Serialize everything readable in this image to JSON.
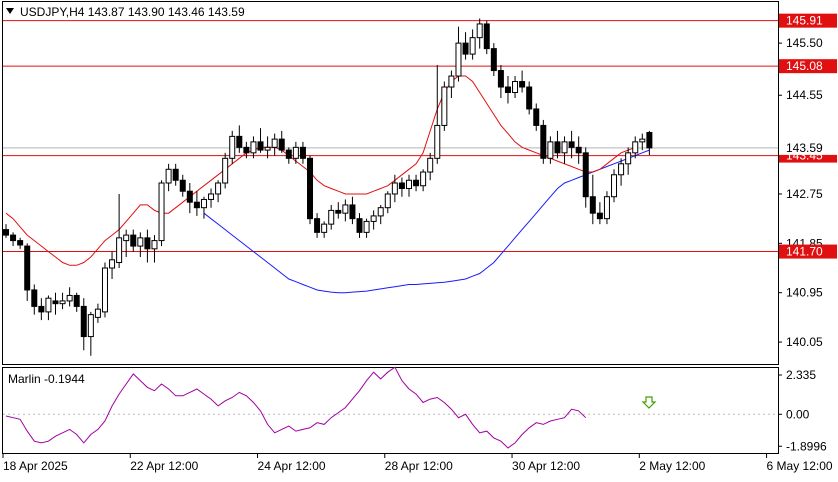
{
  "header": {
    "symbol_line": "USDJPY,H4  143.87 143.90 143.46 143.59"
  },
  "indicator": {
    "label": "Marlin -0.1944"
  },
  "colors": {
    "bull": "#ffffff",
    "bear": "#000000",
    "red_line": "#e01010",
    "blue_line": "#1a1aff",
    "marlin": "#a000a0",
    "level": "#e01010",
    "arrow": "#40a000",
    "grid": "#bbbbbb"
  },
  "chart_data": [
    {
      "type": "candlestick",
      "title": "USDJPY,H4",
      "ylim": [
        139.65,
        146.25
      ],
      "y_ticks": [
        "145.50",
        "144.55",
        "143.50",
        "142.75",
        "141.85",
        "140.95",
        "140.05"
      ],
      "y_tick_values": [
        145.5,
        144.55,
        143.5,
        142.75,
        141.85,
        140.95,
        140.05
      ],
      "x_labels": [
        "18 Apr 2025",
        "22 Apr 12:00",
        "24 Apr 12:00",
        "28 Apr 12:00",
        "30 Apr 12:00",
        "2 May 12:00",
        "6 May 12:00"
      ],
      "x_label_index": [
        0,
        18,
        36,
        54,
        72,
        90,
        108
      ],
      "current_price": "143.59",
      "levels": [
        {
          "value": 145.91,
          "label": "145.91"
        },
        {
          "value": 145.08,
          "label": "145.08"
        },
        {
          "value": 143.45,
          "label": "143.45"
        },
        {
          "value": 141.7,
          "label": "141.70"
        }
      ],
      "candles": [
        [
          142.1,
          142.2,
          141.95,
          142.0
        ],
        [
          142.0,
          142.05,
          141.8,
          141.9
        ],
        [
          141.9,
          141.95,
          141.75,
          141.82
        ],
        [
          141.8,
          141.85,
          140.8,
          141.0
        ],
        [
          141.0,
          141.1,
          140.55,
          140.7
        ],
        [
          140.7,
          140.85,
          140.45,
          140.6
        ],
        [
          140.6,
          140.9,
          140.45,
          140.85
        ],
        [
          140.8,
          140.95,
          140.55,
          140.75
        ],
        [
          140.75,
          140.95,
          140.65,
          140.8
        ],
        [
          140.8,
          141.05,
          140.7,
          140.9
        ],
        [
          140.9,
          140.95,
          140.6,
          140.7
        ],
        [
          140.7,
          140.85,
          139.9,
          140.15
        ],
        [
          140.15,
          140.6,
          139.8,
          140.55
        ],
        [
          140.5,
          140.75,
          140.4,
          140.65
        ],
        [
          140.6,
          141.5,
          140.5,
          141.4
        ],
        [
          141.4,
          141.7,
          141.2,
          141.55
        ],
        [
          141.5,
          142.75,
          141.4,
          141.95
        ],
        [
          141.9,
          142.1,
          141.6,
          142.0
        ],
        [
          142.0,
          142.1,
          141.7,
          141.8
        ],
        [
          141.8,
          142.05,
          141.6,
          141.95
        ],
        [
          141.95,
          142.1,
          141.5,
          141.75
        ],
        [
          141.75,
          142.0,
          141.5,
          141.9
        ],
        [
          141.9,
          143.0,
          141.8,
          142.95
        ],
        [
          142.95,
          143.3,
          142.8,
          143.2
        ],
        [
          143.2,
          143.3,
          142.9,
          143.0
        ],
        [
          143.0,
          143.1,
          142.7,
          142.8
        ],
        [
          142.8,
          142.95,
          142.4,
          142.6
        ],
        [
          142.6,
          142.8,
          142.35,
          142.5
        ],
        [
          142.5,
          142.7,
          142.3,
          142.65
        ],
        [
          142.65,
          142.85,
          142.5,
          142.75
        ],
        [
          142.75,
          143.0,
          142.6,
          142.95
        ],
        [
          142.95,
          143.5,
          142.85,
          143.4
        ],
        [
          143.4,
          143.9,
          143.3,
          143.8
        ],
        [
          143.8,
          144.0,
          143.5,
          143.6
        ],
        [
          143.6,
          143.7,
          143.4,
          143.5
        ],
        [
          143.5,
          143.8,
          143.4,
          143.7
        ],
        [
          143.7,
          143.95,
          143.5,
          143.55
        ],
        [
          143.55,
          143.8,
          143.4,
          143.6
        ],
        [
          143.6,
          143.85,
          143.45,
          143.75
        ],
        [
          143.75,
          143.9,
          143.5,
          143.55
        ],
        [
          143.55,
          143.6,
          143.3,
          143.4
        ],
        [
          143.4,
          143.7,
          143.3,
          143.6
        ],
        [
          143.6,
          143.7,
          143.3,
          143.4
        ],
        [
          143.4,
          143.45,
          142.2,
          142.3
        ],
        [
          142.3,
          142.4,
          141.95,
          142.05
        ],
        [
          142.05,
          142.25,
          141.95,
          142.2
        ],
        [
          142.2,
          142.55,
          142.1,
          142.45
        ],
        [
          142.45,
          142.6,
          142.3,
          142.4
        ],
        [
          142.4,
          142.65,
          142.25,
          142.55
        ],
        [
          142.55,
          142.7,
          142.2,
          142.3
        ],
        [
          142.3,
          142.4,
          141.95,
          142.05
        ],
        [
          142.05,
          142.3,
          141.95,
          142.25
        ],
        [
          142.25,
          142.45,
          142.1,
          142.35
        ],
        [
          142.35,
          142.55,
          142.2,
          142.5
        ],
        [
          142.5,
          142.8,
          142.4,
          142.75
        ],
        [
          142.75,
          143.1,
          142.6,
          142.95
        ],
        [
          142.95,
          143.05,
          142.7,
          142.85
        ],
        [
          142.85,
          143.1,
          142.7,
          143.0
        ],
        [
          143.0,
          143.1,
          142.8,
          142.9
        ],
        [
          142.9,
          143.2,
          142.8,
          143.15
        ],
        [
          143.15,
          143.5,
          143.0,
          143.4
        ],
        [
          143.4,
          145.1,
          143.3,
          144.0
        ],
        [
          144.0,
          144.8,
          143.9,
          144.7
        ],
        [
          144.7,
          145.0,
          144.5,
          144.9
        ],
        [
          144.9,
          145.8,
          144.8,
          145.5
        ],
        [
          145.5,
          145.7,
          145.2,
          145.3
        ],
        [
          145.3,
          145.75,
          145.2,
          145.6
        ],
        [
          145.6,
          145.95,
          145.4,
          145.85
        ],
        [
          145.85,
          145.91,
          145.3,
          145.4
        ],
        [
          145.4,
          145.5,
          144.9,
          145.0
        ],
        [
          145.0,
          145.1,
          144.5,
          144.7
        ],
        [
          144.7,
          144.9,
          144.4,
          144.6
        ],
        [
          144.6,
          144.9,
          144.5,
          144.8
        ],
        [
          144.8,
          145.0,
          144.6,
          144.7
        ],
        [
          144.7,
          144.8,
          144.2,
          144.3
        ],
        [
          144.3,
          144.4,
          143.9,
          144.0
        ],
        [
          144.0,
          144.1,
          143.3,
          143.4
        ],
        [
          143.4,
          143.8,
          143.3,
          143.7
        ],
        [
          143.7,
          143.9,
          143.4,
          143.5
        ],
        [
          143.5,
          143.8,
          143.3,
          143.7
        ],
        [
          143.7,
          143.9,
          143.4,
          143.6
        ],
        [
          143.6,
          143.8,
          143.3,
          143.5
        ],
        [
          143.5,
          143.6,
          142.5,
          142.7
        ],
        [
          142.7,
          143.1,
          142.2,
          142.4
        ],
        [
          142.4,
          142.6,
          142.2,
          142.3
        ],
        [
          142.3,
          142.8,
          142.2,
          142.7
        ],
        [
          142.7,
          143.2,
          142.6,
          143.1
        ],
        [
          143.1,
          143.4,
          142.9,
          143.3
        ],
        [
          143.3,
          143.6,
          143.1,
          143.5
        ],
        [
          143.5,
          143.8,
          143.4,
          143.7
        ],
        [
          143.7,
          143.85,
          143.55,
          143.75
        ],
        [
          143.87,
          143.9,
          143.46,
          143.59
        ]
      ],
      "red_ma": [
        142.4,
        142.3,
        142.15,
        142.0,
        141.9,
        141.8,
        141.7,
        141.6,
        141.5,
        141.45,
        141.45,
        141.5,
        141.6,
        141.75,
        141.9,
        142.0,
        142.1,
        142.25,
        142.4,
        142.55,
        142.55,
        142.45,
        142.4,
        142.4,
        142.5,
        142.6,
        142.7,
        142.8,
        142.9,
        143.0,
        143.1,
        143.2,
        143.3,
        143.4,
        143.5,
        143.55,
        143.6,
        143.6,
        143.6,
        143.55,
        143.45,
        143.35,
        143.25,
        143.15,
        143.0,
        142.9,
        142.85,
        142.8,
        142.75,
        142.75,
        142.75,
        142.75,
        142.8,
        142.85,
        142.9,
        143.0,
        143.1,
        143.2,
        143.3,
        143.5,
        143.9,
        144.3,
        144.6,
        144.8,
        144.9,
        144.9,
        144.8,
        144.6,
        144.4,
        144.2,
        144.0,
        143.85,
        143.7,
        143.6,
        143.55,
        143.5,
        143.45,
        143.4,
        143.35,
        143.3,
        143.25,
        143.2,
        143.15,
        143.15,
        143.2,
        143.3,
        143.4,
        143.5,
        143.55,
        143.6
      ],
      "blue_ma": [
        142.4,
        142.3,
        142.2,
        142.1,
        142.0,
        141.9,
        141.8,
        141.7,
        141.6,
        141.5,
        141.4,
        141.3,
        141.2,
        141.15,
        141.1,
        141.05,
        141.0,
        140.98,
        140.96,
        140.95,
        140.95,
        140.96,
        140.97,
        140.98,
        141.0,
        141.02,
        141.04,
        141.06,
        141.08,
        141.1,
        141.1,
        141.11,
        141.12,
        141.13,
        141.14,
        141.16,
        141.18,
        141.2,
        141.25,
        141.3,
        141.4,
        141.5,
        141.65,
        141.8,
        141.95,
        142.1,
        142.25,
        142.4,
        142.55,
        142.7,
        142.85,
        142.95,
        143.0,
        143.05,
        143.1,
        143.15,
        143.2,
        143.25,
        143.3,
        143.35,
        143.4,
        143.45,
        143.5,
        143.55
      ],
      "blue_ma_start_index": 28
    },
    {
      "type": "line",
      "title": "Marlin -0.1944",
      "ylim": [
        -2.3,
        2.75
      ],
      "y_ticks": [
        "2.335",
        "0.00",
        "-1.8996"
      ],
      "y_tick_values": [
        2.335,
        0.0,
        -1.8996
      ],
      "series": [
        {
          "name": "Marlin",
          "values": [
            -0.1,
            -0.2,
            -0.3,
            -1.0,
            -1.6,
            -1.7,
            -1.6,
            -1.3,
            -1.1,
            -0.9,
            -1.2,
            -1.7,
            -1.2,
            -0.9,
            -0.4,
            0.5,
            1.2,
            1.8,
            2.4,
            2.0,
            1.6,
            1.4,
            1.8,
            1.5,
            1.1,
            1.1,
            1.3,
            1.5,
            1.2,
            0.9,
            0.5,
            0.8,
            1.0,
            1.3,
            1.1,
            0.7,
            0.2,
            -0.6,
            -1.1,
            -0.9,
            -0.7,
            -1.0,
            -0.9,
            -0.8,
            -0.5,
            -0.6,
            -0.2,
            0.1,
            0.4,
            0.9,
            1.4,
            2.0,
            2.5,
            2.1,
            2.5,
            2.8,
            2.0,
            1.5,
            1.2,
            0.7,
            0.9,
            1.0,
            0.7,
            0.3,
            -0.2,
            0.0,
            -0.6,
            -1.1,
            -1.0,
            -1.4,
            -1.6,
            -2.0,
            -1.7,
            -1.2,
            -0.8,
            -0.5,
            -0.6,
            -0.4,
            -0.3,
            -0.2,
            0.3,
            0.2,
            -0.2
          ]
        }
      ]
    }
  ]
}
